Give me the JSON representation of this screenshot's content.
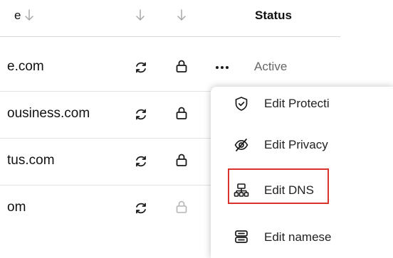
{
  "header": {
    "domain_col": "e",
    "status_col": "Status"
  },
  "rows": [
    {
      "domain": "e.com",
      "status": "Active",
      "lock_style": "dark"
    },
    {
      "domain": "ousiness.com",
      "lock_style": "dark"
    },
    {
      "domain": "tus.com",
      "lock_style": "dark"
    },
    {
      "domain": "om",
      "lock_style": "light"
    }
  ],
  "menu": {
    "items": [
      {
        "label": "Edit Protecti",
        "icon": "shield-check-icon"
      },
      {
        "label": "Edit Privacy",
        "icon": "eye-off-icon"
      },
      {
        "label": "Edit DNS",
        "icon": "network-tree-icon"
      },
      {
        "label": "Edit namese",
        "icon": "server-icon"
      }
    ]
  },
  "colors": {
    "highlight": "#d9332b",
    "status_text": "#666666",
    "light_lock": "#b5b5b5"
  }
}
